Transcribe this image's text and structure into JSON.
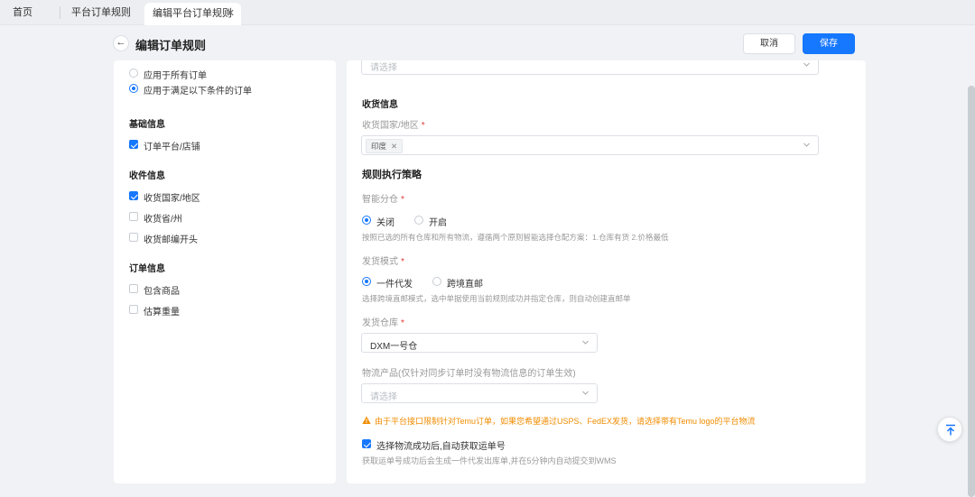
{
  "tabs": {
    "home": "首页",
    "rules": "平台订单规则",
    "active": "编辑平台订单规则",
    "close_glyph": "✕"
  },
  "header": {
    "back_glyph": "←",
    "title": "编辑订单规则",
    "cancel_label": "取消",
    "save_label": "保存"
  },
  "left": {
    "scope_options": [
      {
        "label": "应用于所有订单",
        "selected": false
      },
      {
        "label": "应用于满足以下条件的订单",
        "selected": true
      }
    ],
    "sections": [
      {
        "title": "基础信息",
        "items": [
          {
            "label": "订单平台/店铺",
            "checked": true
          }
        ]
      },
      {
        "title": "收件信息",
        "items": [
          {
            "label": "收货国家/地区",
            "checked": true
          },
          {
            "label": "收货省/州",
            "checked": false
          },
          {
            "label": "收货邮编开头",
            "checked": false
          }
        ]
      },
      {
        "title": "订单信息",
        "items": [
          {
            "label": "包含商品",
            "checked": false
          },
          {
            "label": "估算重量",
            "checked": false
          }
        ]
      }
    ]
  },
  "right": {
    "top_select_placeholder": "请选择",
    "receipt_section_title": "收货信息",
    "country_label": "收货国家/地区",
    "required_mark": "*",
    "country_tag": "印度",
    "tag_close": "✕",
    "strategy_title": "规则执行策略",
    "smart_split_label": "智能分仓",
    "smart_split_options": [
      {
        "label": "关闭",
        "selected": true
      },
      {
        "label": "开启",
        "selected": false
      }
    ],
    "smart_split_help": "按照已选的所有仓库和所有物流，遵循两个原则智能选择仓配方案：1.仓库有货 2.价格最低",
    "ship_mode_label": "发货模式",
    "ship_mode_options": [
      {
        "label": "一件代发",
        "selected": true
      },
      {
        "label": "跨境直邮",
        "selected": false
      }
    ],
    "ship_mode_help": "选择跨境直邮模式，选中单据使用当前规则成功并指定仓库，则自动创建直邮单",
    "warehouse_label": "发货仓库",
    "warehouse_value": "DXM一号仓",
    "logistics_label": "物流产品(仅针对同步订单时没有物流信息的订单生效)",
    "logistics_placeholder": "请选择",
    "warning_text": "由于平台接口限制针对Temu订单，如果您希望通过USPS、FedEX发货，请选择带有Temu logo的平台物流",
    "auto_track_label": "选择物流成功后,自动获取运单号",
    "auto_track_checked": true,
    "auto_track_help": "获取运单号成功后会生成一件代发出库单,并在5分钟内自动提交到WMS"
  },
  "colors": {
    "primary": "#1677ff",
    "warning": "#f08c00",
    "required": "#e53935"
  }
}
